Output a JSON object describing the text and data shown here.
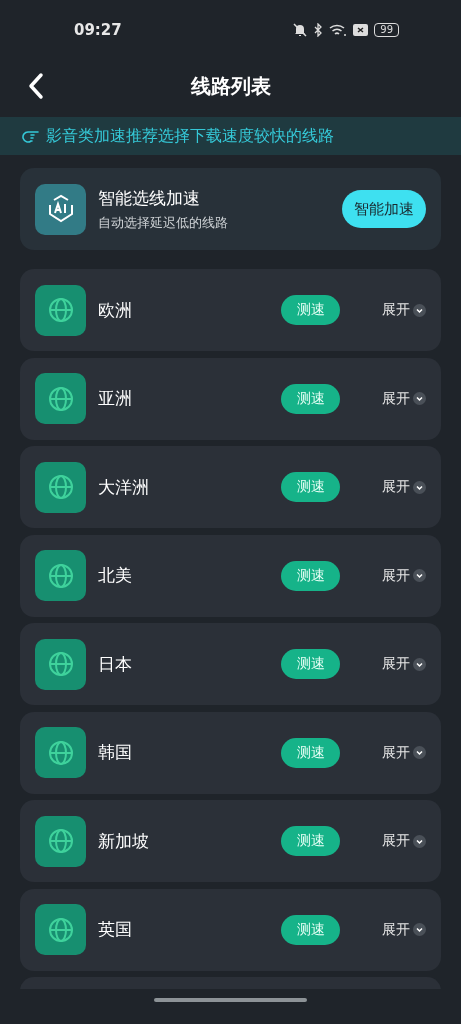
{
  "status_bar": {
    "time": "09:27",
    "battery": "99"
  },
  "header": {
    "title": "线路列表"
  },
  "banner": {
    "text": "影音类加速推荐选择下载速度较快的线路"
  },
  "smart_card": {
    "title": "智能选线加速",
    "subtitle": "自动选择延迟低的线路",
    "button": "智能加速"
  },
  "routes": [
    {
      "name": "欧洲",
      "test_button": "测速",
      "expand": "展开"
    },
    {
      "name": "亚洲",
      "test_button": "测速",
      "expand": "展开"
    },
    {
      "name": "大洋洲",
      "test_button": "测速",
      "expand": "展开"
    },
    {
      "name": "北美",
      "test_button": "测速",
      "expand": "展开"
    },
    {
      "name": "日本",
      "test_button": "测速",
      "expand": "展开"
    },
    {
      "name": "韩国",
      "test_button": "测速",
      "expand": "展开"
    },
    {
      "name": "新加坡",
      "test_button": "测速",
      "expand": "展开"
    },
    {
      "name": "英国",
      "test_button": "测速",
      "expand": "展开"
    }
  ]
}
